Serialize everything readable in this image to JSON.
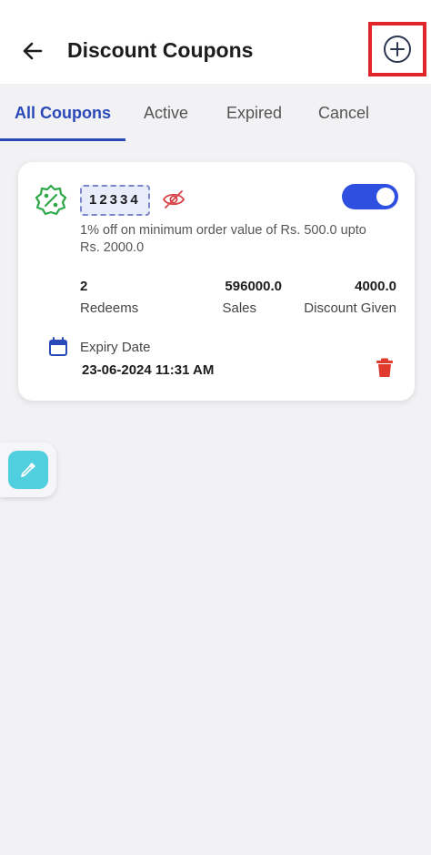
{
  "header": {
    "title": "Discount Coupons",
    "back_icon": "arrow-left-icon",
    "add_icon": "plus-circle-icon"
  },
  "tabs": [
    {
      "label": "All Coupons",
      "active": true
    },
    {
      "label": "Active",
      "active": false
    },
    {
      "label": "Expired",
      "active": false
    },
    {
      "label": "Cancel",
      "active": false
    }
  ],
  "coupon": {
    "code": "12334",
    "enabled": true,
    "description": "1% off on minimum order value of Rs. 500.0 upto Rs. 2000.0",
    "stats": [
      {
        "value": "2",
        "label": "Redeems"
      },
      {
        "value": "596000.0",
        "label": "Sales"
      },
      {
        "value": "4000.0",
        "label": "Discount Given"
      }
    ],
    "expiry_label": "Expiry Date",
    "expiry_value": "23-06-2024 11:31 AM"
  },
  "colors": {
    "accent": "#2a49b8",
    "toggle": "#2f4fe0",
    "highlight_box": "#e0262a",
    "badge_green": "#2fa84a",
    "trash_red": "#e03a2f",
    "fab": "#4fcfe0"
  }
}
